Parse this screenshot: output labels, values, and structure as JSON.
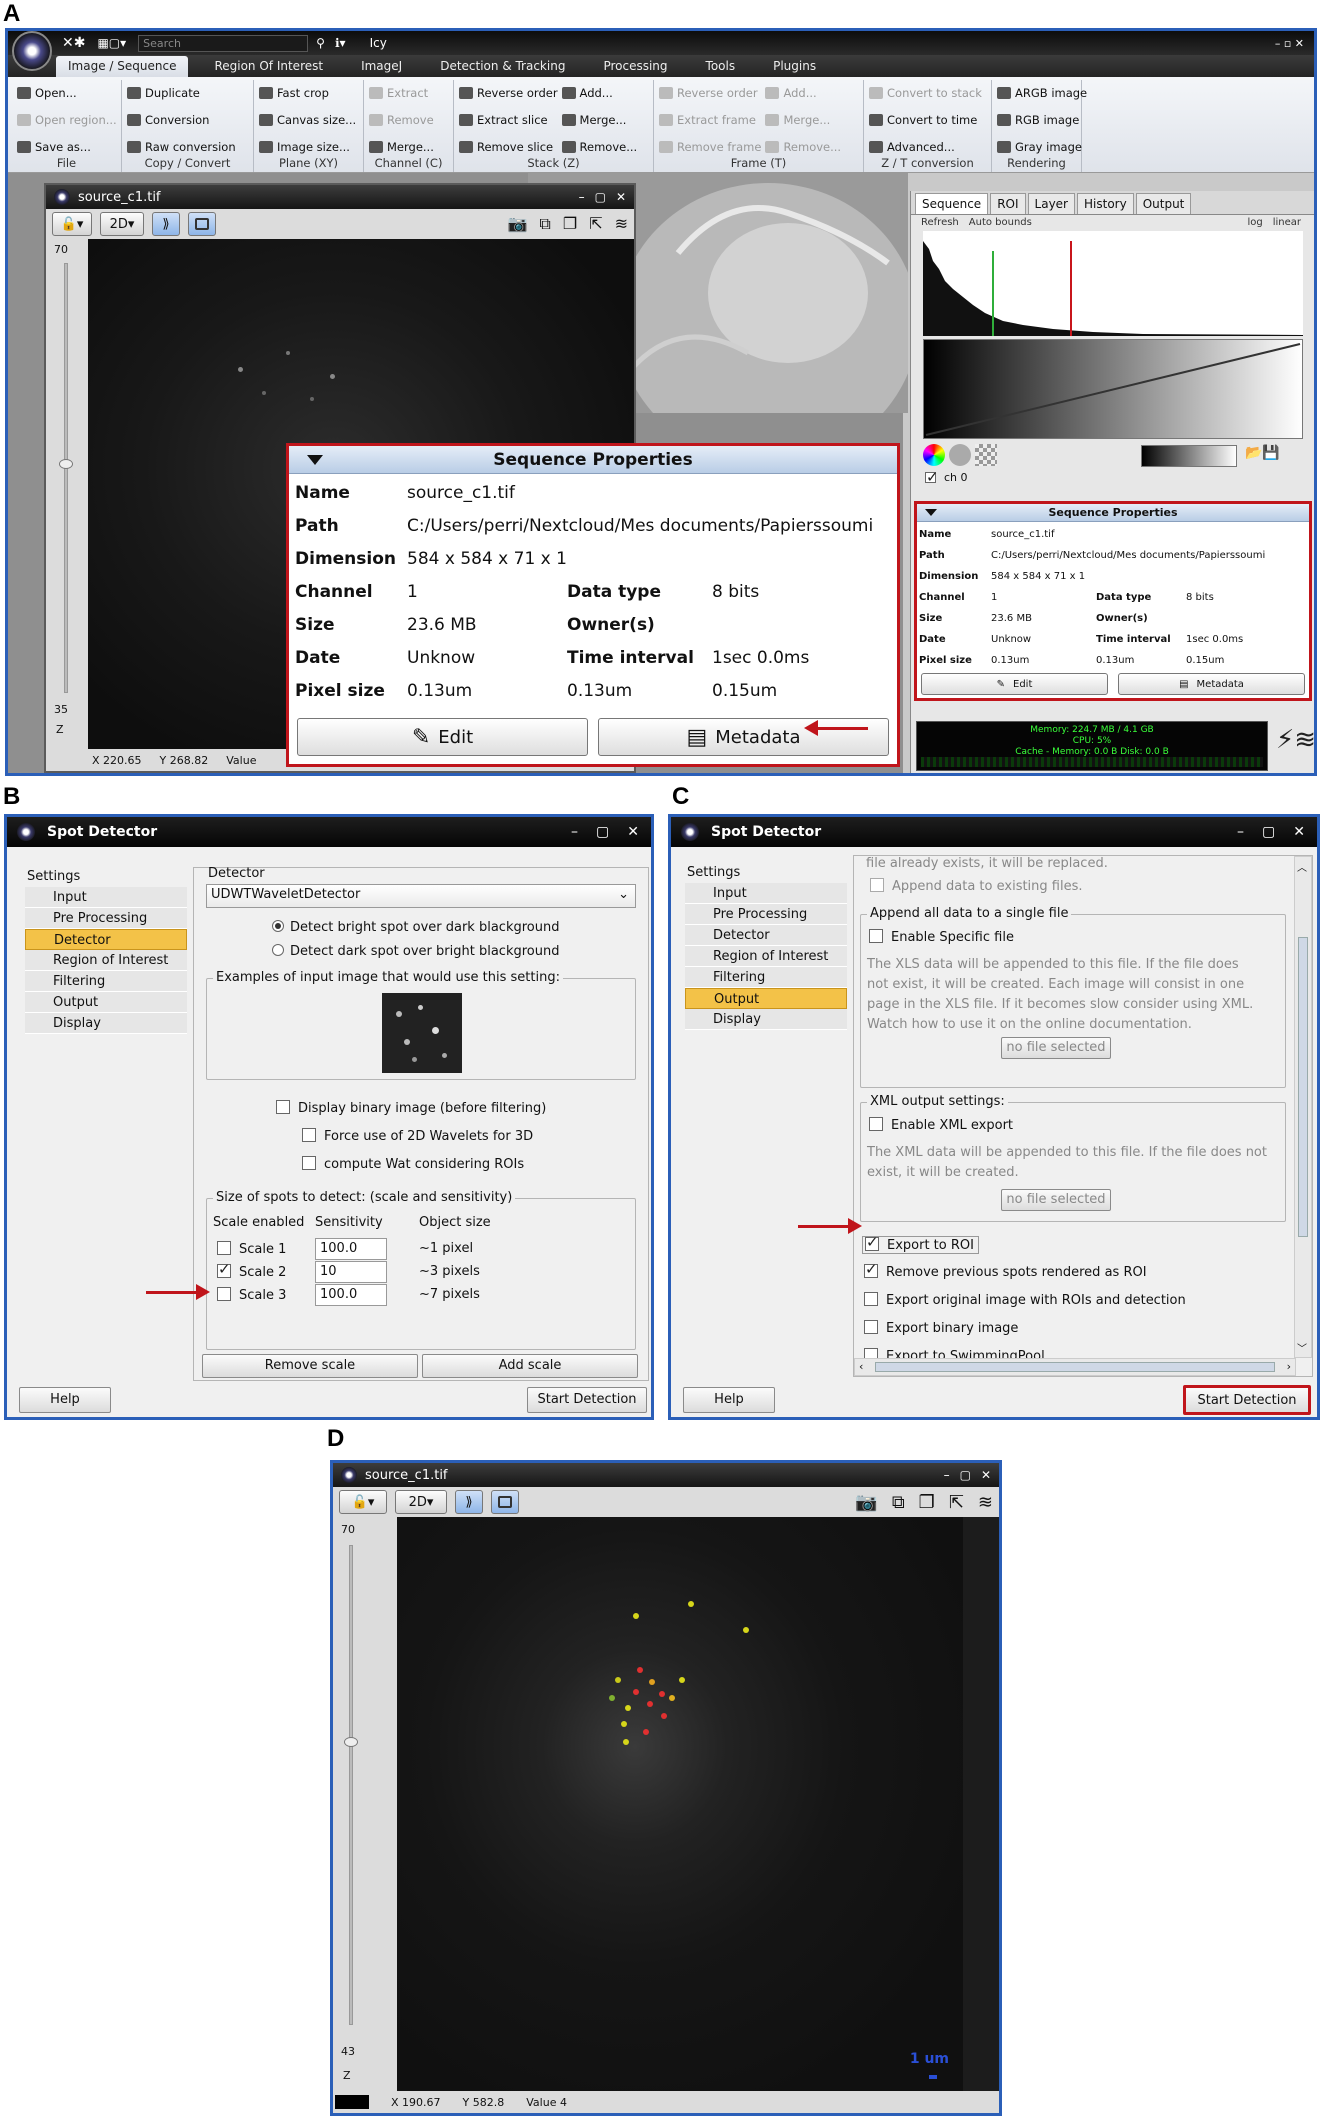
{
  "panels": {
    "a": "A",
    "b": "B",
    "c": "C",
    "d": "D"
  },
  "app": {
    "title": "Icy",
    "search_placeholder": "Search",
    "tabs": [
      "Image / Sequence",
      "Region Of Interest",
      "ImageJ",
      "Detection & Tracking",
      "Processing",
      "Tools",
      "Plugins"
    ],
    "groups": [
      {
        "label": "File",
        "cols": [
          [
            "Open...",
            "Open region...",
            "Save as..."
          ]
        ],
        "dim": [
          false,
          true,
          false
        ]
      },
      {
        "label": "Copy / Convert",
        "cols": [
          [
            "Duplicate",
            "Conversion",
            "Raw conversion"
          ]
        ],
        "dim": [
          false,
          false,
          false
        ]
      },
      {
        "label": "Plane (XY)",
        "cols": [
          [
            "Fast crop",
            "Canvas size...",
            "Image size..."
          ]
        ],
        "dim": [
          false,
          false,
          false
        ]
      },
      {
        "label": "Channel (C)",
        "cols": [
          [
            "Extract",
            "Remove",
            "Merge..."
          ]
        ],
        "dim": [
          true,
          true,
          false
        ]
      },
      {
        "label": "Stack (Z)",
        "cols": [
          [
            "Reverse order",
            "Extract slice",
            "Remove slice"
          ],
          [
            "Add...",
            "Merge...",
            "Remove..."
          ]
        ],
        "dim": [
          false,
          false,
          false
        ]
      },
      {
        "label": "Frame (T)",
        "cols": [
          [
            "Reverse order",
            "Extract frame",
            "Remove frame"
          ],
          [
            "Add...",
            "Merge...",
            "Remove..."
          ]
        ],
        "dim": [
          true,
          true,
          true
        ]
      },
      {
        "label": "Z / T conversion",
        "cols": [
          [
            "Convert to stack",
            "Convert to time",
            "Advanced..."
          ]
        ],
        "dim": [
          true,
          false,
          false
        ]
      },
      {
        "label": "Rendering",
        "cols": [
          [
            "ARGB image",
            "RGB image",
            "Gray image"
          ]
        ],
        "dim": [
          false,
          false,
          false
        ]
      }
    ]
  },
  "viewer_a": {
    "title": "source_c1.tif",
    "mode": "2D",
    "slider_max": "70",
    "slider_val": "35",
    "z_label": "Z",
    "coord_x": "X 220.65",
    "coord_y": "Y 268.82",
    "value_label": "Value"
  },
  "inspector": {
    "tabs": [
      "Sequence",
      "ROI",
      "Layer",
      "History",
      "Output"
    ],
    "refresh": "Refresh",
    "auto_bounds": "Auto bounds",
    "log": "log",
    "linear": "linear",
    "channel": "ch 0",
    "memory": "Memory: 224.7 MB / 4.1 GB",
    "cpu": "CPU: 5%",
    "cache": "Cache - Memory: 0.0 B  Disk: 0.0 B"
  },
  "seqprops": {
    "header": "Sequence Properties",
    "name_k": "Name",
    "name_v": "source_c1.tif",
    "path_k": "Path",
    "path_v": "C:/Users/perri/Nextcloud/Mes documents/Papierssoumi",
    "dim_k": "Dimension",
    "dim_v": "584 x 584 x 71 x 1",
    "channel_k": "Channel",
    "channel_v": "1",
    "dtype_k": "Data type",
    "dtype_v": "8 bits",
    "size_k": "Size",
    "size_v": "23.6 MB",
    "owner_k": "Owner(s)",
    "date_k": "Date",
    "date_v": "Unknow",
    "tint_k": "Time interval",
    "tint_v": "1sec 0.0ms",
    "px_k": "Pixel size",
    "px_x": "0.13um",
    "px_y": "0.13um",
    "px_z": "0.15um",
    "edit": "Edit",
    "metadata": "Metadata"
  },
  "spot_b": {
    "title": "Spot Detector",
    "settings": "Settings",
    "nav": [
      "Input",
      "Pre Processing",
      "Detector",
      "Region of Interest",
      "Filtering",
      "Output",
      "Display"
    ],
    "active": "Detector",
    "detector_legend": "Detector",
    "detector_value": "UDWTWaveletDetector",
    "opt_bright": "Detect bright spot over dark blackground",
    "opt_dark": "Detect dark spot over bright blackground",
    "examples_legend": "Examples of input image that would use this setting:",
    "binary": "Display binary image (before filtering)",
    "force2d": "Force use of 2D Wavelets for 3D",
    "wat": "compute Wat considering ROIs",
    "size_legend": "Size of spots to detect: (scale and sensitivity)",
    "col_scale": "Scale enabled",
    "col_sens": "Sensitivity",
    "col_obj": "Object size",
    "scales": [
      {
        "label": "Scale 1",
        "sens": "100.0",
        "obj": "~1 pixel",
        "on": false
      },
      {
        "label": "Scale 2",
        "sens": "10",
        "obj": "~3 pixels",
        "on": true
      },
      {
        "label": "Scale 3",
        "sens": "100.0",
        "obj": "~7 pixels",
        "on": false
      }
    ],
    "remove_scale": "Remove scale",
    "add_scale": "Add scale",
    "help": "Help",
    "start": "Start Detection"
  },
  "spot_c": {
    "title": "Spot Detector",
    "settings": "Settings",
    "nav": [
      "Input",
      "Pre Processing",
      "Detector",
      "Region of Interest",
      "Filtering",
      "Output",
      "Display"
    ],
    "active": "Output",
    "top_cut": "file already exists, it will be replaced.",
    "append_existing": "Append data to existing files.",
    "append_legend": "Append all data to a single file",
    "enable_specific": "Enable Specific file",
    "xls_note": [
      "The XLS data will be appended to this file. If the file does",
      "not exist, it will be created. Each image will consist in one",
      "page in the XLS file. If it becomes slow consider using XML.",
      "Watch how to use it on the online documentation."
    ],
    "no_file": "no file selected",
    "xml_legend": "XML output settings:",
    "enable_xml": "Enable XML export",
    "xml_note": [
      "The XML data will be appended to this file. If the file does not",
      "exist, it will be created."
    ],
    "export_roi": "Export to ROI",
    "remove_prev": "Remove previous spots rendered as ROI",
    "export_orig": "Export original image with ROIs and detection",
    "export_bin": "Export binary image",
    "export_swim": "Export to SwimmingPool",
    "help": "Help",
    "start": "Start Detection"
  },
  "viewer_d": {
    "title": "source_c1.tif",
    "mode": "2D",
    "slider_max": "70",
    "slider_val": "43",
    "z_label": "Z",
    "scale_bar": "1 um",
    "coord_x": "X 190.67",
    "coord_y": "Y 582.8",
    "value": "Value 4"
  }
}
